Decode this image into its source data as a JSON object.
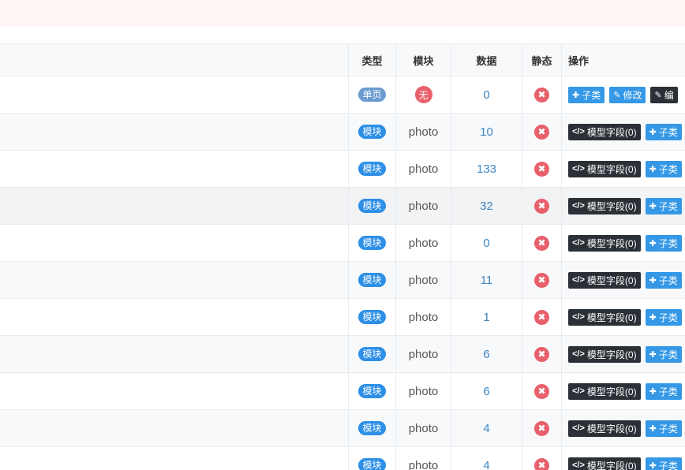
{
  "header": {
    "type": "类型",
    "module": "模块",
    "data": "数据",
    "static": "静态",
    "ops": "操作"
  },
  "buttons": {
    "sub": "子类",
    "edit": "修改",
    "edit_cut": "编",
    "fields": "模型字段(0)"
  },
  "icons": {
    "plus": "plus-icon",
    "edit": "edit-icon",
    "code": "code-icon",
    "close": "close-icon"
  },
  "colors": {
    "pill_blue": "#2d8fe6",
    "pill_single": "#6c9bd2",
    "danger": "#e8606b",
    "link": "#3c86c4",
    "btn_blue": "#3498e6",
    "btn_dark": "#2b3037"
  },
  "rows": [
    {
      "type": "单页",
      "module": "无",
      "data": "0"
    },
    {
      "type": "模块",
      "module": "photo",
      "data": "10"
    },
    {
      "type": "模块",
      "module": "photo",
      "data": "133"
    },
    {
      "type": "模块",
      "module": "photo",
      "data": "32"
    },
    {
      "type": "模块",
      "module": "photo",
      "data": "0"
    },
    {
      "type": "模块",
      "module": "photo",
      "data": "11"
    },
    {
      "type": "模块",
      "module": "photo",
      "data": "1"
    },
    {
      "type": "模块",
      "module": "photo",
      "data": "6"
    },
    {
      "type": "模块",
      "module": "photo",
      "data": "6"
    },
    {
      "type": "模块",
      "module": "photo",
      "data": "4"
    },
    {
      "type": "模块",
      "module": "photo",
      "data": "4"
    }
  ]
}
